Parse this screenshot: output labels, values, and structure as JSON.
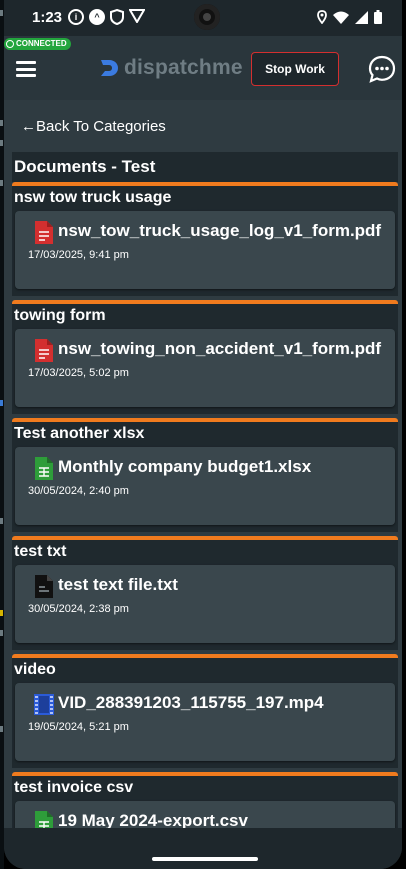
{
  "status_bar": {
    "time": "1:23",
    "icons": [
      "info-icon",
      "app-icon",
      "shield-icon",
      "vpn-icon"
    ],
    "right_icons": [
      "location-icon",
      "wifi-icon",
      "signal-icon",
      "battery-icon"
    ]
  },
  "header": {
    "connected_badge": "CONNECTED",
    "brand": "dispatchme",
    "stop_button": "Stop Work"
  },
  "nav": {
    "back_label": "←Back To Categories"
  },
  "section": {
    "title": "Documents - Test"
  },
  "groups": [
    {
      "name": "nsw tow truck usage",
      "file": "nsw_tow_truck_usage_log_v1_form.pdf",
      "date": "17/03/2025, 9:41 pm",
      "type": "pdf"
    },
    {
      "name": "towing form",
      "file": "nsw_towing_non_accident_v1_form.pdf",
      "date": "17/03/2025, 5:02 pm",
      "type": "pdf"
    },
    {
      "name": "Test another xlsx",
      "file": "Monthly company budget1.xlsx",
      "date": "30/05/2024, 2:40 pm",
      "type": "xlsx"
    },
    {
      "name": "test txt",
      "file": "test text file.txt",
      "date": "30/05/2024, 2:38 pm",
      "type": "txt"
    },
    {
      "name": "video",
      "file": "VID_288391203_115755_197.mp4",
      "date": "19/05/2024, 5:21 pm",
      "type": "video"
    },
    {
      "name": "test invoice csv",
      "file": "19 May 2024-export.csv",
      "date": "",
      "type": "csv"
    }
  ],
  "colors": {
    "accent_orange": "#f07b1e",
    "pdf_red": "#d32f2f",
    "sheet_green": "#2e9d3a",
    "video_blue": "#2b5bd8",
    "connected_green": "#23a53d"
  }
}
